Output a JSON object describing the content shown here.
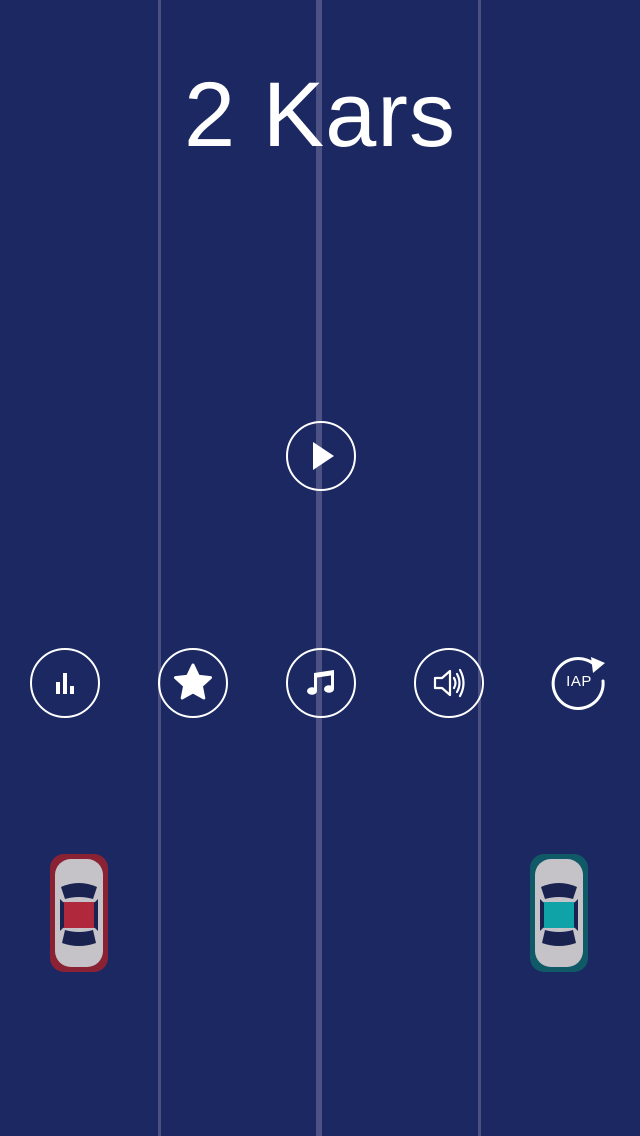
{
  "game": {
    "title": "2 Kars"
  },
  "menu": {
    "play": {
      "icon": "play-icon"
    },
    "buttons": [
      {
        "name": "leaderboard",
        "icon": "bar-chart-icon"
      },
      {
        "name": "rate",
        "icon": "star-icon"
      },
      {
        "name": "music",
        "icon": "music-note-icon"
      },
      {
        "name": "sound",
        "icon": "speaker-icon"
      },
      {
        "name": "restore-purchases",
        "icon": "refresh-icon",
        "label": "IAP"
      }
    ]
  },
  "cars": [
    {
      "name": "left-car",
      "accent_color": "#8a2234",
      "cabin_color": "#b0283c"
    },
    {
      "name": "right-car",
      "accent_color": "#0f5a66",
      "cabin_color": "#0fa3a8"
    }
  ],
  "colors": {
    "background": "#1b2862",
    "lane_line": "#4a5182",
    "foreground": "#ffffff"
  }
}
